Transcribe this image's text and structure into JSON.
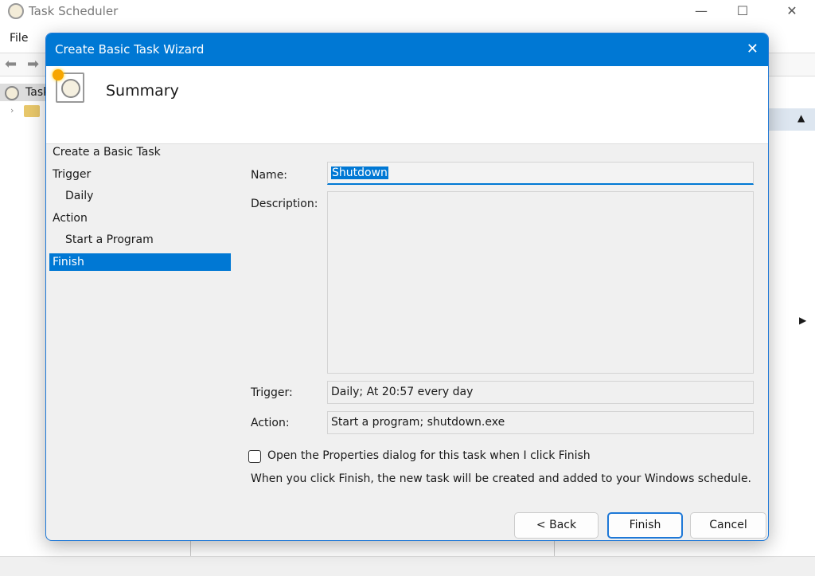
{
  "app": {
    "title": "Task Scheduler",
    "menu": [
      "File"
    ],
    "tree_item": "Task"
  },
  "dialog": {
    "title": "Create Basic Task Wizard",
    "heading": "Summary",
    "steps": [
      {
        "label": "Create a Basic Task",
        "sub": false,
        "selected": false
      },
      {
        "label": "Trigger",
        "sub": false,
        "selected": false
      },
      {
        "label": "Daily",
        "sub": true,
        "selected": false
      },
      {
        "label": "Action",
        "sub": false,
        "selected": false
      },
      {
        "label": "Start a Program",
        "sub": true,
        "selected": false
      },
      {
        "label": "Finish",
        "sub": false,
        "selected": true
      }
    ],
    "name_label": "Name:",
    "name_value": "Shutdown",
    "description_label": "Description:",
    "description_value": "",
    "trigger_label": "Trigger:",
    "trigger_value": "Daily; At 20:57 every day",
    "action_label": "Action:",
    "action_value": "Start a program; shutdown.exe",
    "checkbox_label": "Open the Properties dialog for this task when I click Finish",
    "checkbox_checked": false,
    "note": "When you click Finish, the new task will be created and added to your Windows schedule.",
    "buttons": {
      "back": "< Back",
      "finish": "Finish",
      "cancel": "Cancel"
    }
  },
  "colors": {
    "accent": "#0078d4"
  }
}
